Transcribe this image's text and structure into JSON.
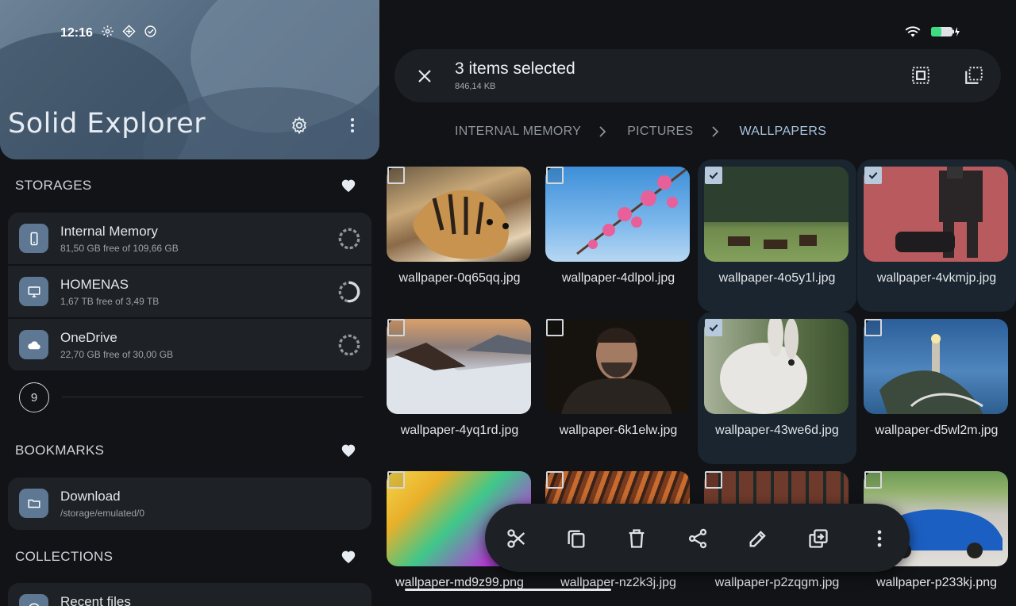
{
  "status_bar": {
    "time": "12:16",
    "left_icons": [
      "gear-icon",
      "diamond-icon",
      "check-circle-icon"
    ],
    "right_icons": [
      "wifi-icon",
      "battery-charging-icon"
    ]
  },
  "app": {
    "title": "Solid Explorer",
    "settings_icon": "gear-icon",
    "menu_icon": "more-vert-icon"
  },
  "storages": {
    "title": "STORAGES",
    "items": [
      {
        "name": "Internal Memory",
        "info": "81,50 GB free of 109,66 GB",
        "icon": "phone-icon",
        "used_fraction": 0.26
      },
      {
        "name": "HOMENAS",
        "info": "1,67 TB free of 3,49 TB",
        "icon": "monitor-icon",
        "used_fraction": 0.52
      },
      {
        "name": "OneDrive",
        "info": "22,70 GB free of 30,00 GB",
        "icon": "cloud-icon",
        "used_fraction": 0.24
      }
    ],
    "more_count": "9"
  },
  "bookmarks": {
    "title": "BOOKMARKS",
    "items": [
      {
        "name": "Download",
        "path": "/storage/emulated/0",
        "icon": "folder-icon"
      }
    ]
  },
  "collections": {
    "title": "COLLECTIONS",
    "items": [
      {
        "name": "Recent files",
        "icon": "clock-icon"
      }
    ]
  },
  "selection": {
    "title": "3 items selected",
    "size": "846,14 KB"
  },
  "breadcrumb": [
    "INTERNAL MEMORY",
    "PICTURES",
    "WALLPAPERS"
  ],
  "files": [
    {
      "name": "wallpaper-0q65qq.jpg",
      "selected": false
    },
    {
      "name": "wallpaper-4dlpol.jpg",
      "selected": false
    },
    {
      "name": "wallpaper-4o5y1l.jpg",
      "selected": true
    },
    {
      "name": "wallpaper-4vkmjp.jpg",
      "selected": true
    },
    {
      "name": "wallpaper-4yq1rd.jpg",
      "selected": false
    },
    {
      "name": "wallpaper-6k1elw.jpg",
      "selected": false
    },
    {
      "name": "wallpaper-43we6d.jpg",
      "selected": true
    },
    {
      "name": "wallpaper-d5wl2m.jpg",
      "selected": false
    },
    {
      "name": "wallpaper-md9z99.png",
      "selected": false
    },
    {
      "name": "wallpaper-nz2k3j.jpg",
      "selected": false
    },
    {
      "name": "wallpaper-p2zqgm.jpg",
      "selected": false
    },
    {
      "name": "wallpaper-p233kj.png",
      "selected": false
    }
  ],
  "actions": [
    "cut-icon",
    "copy-icon",
    "delete-icon",
    "share-icon",
    "rename-icon",
    "move-icon",
    "more-vert-icon"
  ],
  "colors": {
    "accent": "#a9c2dd",
    "surface": "#1e2227",
    "background": "#111316",
    "icon_tile": "#5e7893",
    "selected_tile": "#1a2530"
  }
}
